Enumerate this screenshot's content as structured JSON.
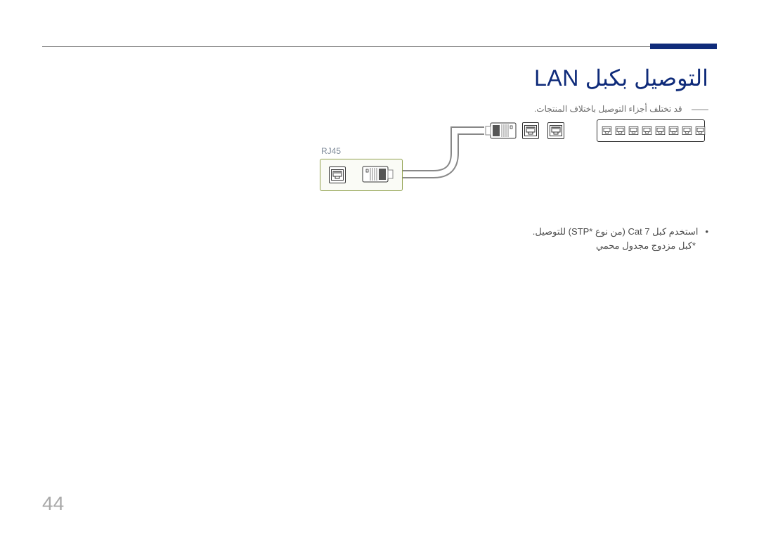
{
  "title": "التوصيل بكبل LAN",
  "subnote": "قد تختلف أجزاء التوصيل باختلاف المنتجات.",
  "rj45_label": "RJ45",
  "notes": {
    "line1": "استخدم كبل Cat 7 (من نوع *STP) للتوصيل.",
    "line2": "*كبل مزدوج مجدول محمي"
  },
  "page_number": "44",
  "icons": {
    "port": "rj45-port-icon",
    "plug": "rj45-plug-icon",
    "switch": "network-switch-icon"
  }
}
